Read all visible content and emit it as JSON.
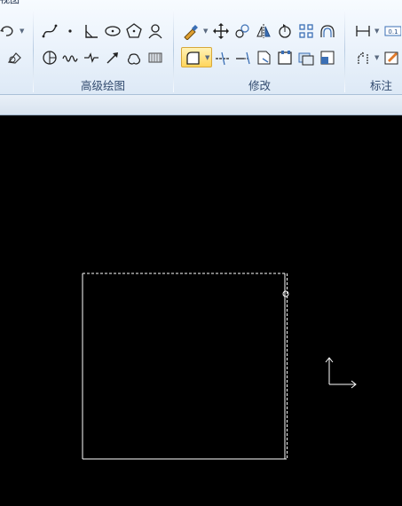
{
  "ribbon": {
    "view_tab_partial": "视图",
    "groups": {
      "advanced_draw": {
        "label": "高级绘图"
      },
      "modify": {
        "label": "修改"
      },
      "annotate": {
        "label": "标注"
      }
    },
    "colors": {
      "ribbon_bg": "#eaf2fb",
      "highlight": "#ffd55c",
      "canvas": "#000000",
      "stroke": "#ffffff"
    }
  },
  "canvas": {
    "shape": "rectangle",
    "ucs_icon": "ucs-axis-icon"
  }
}
